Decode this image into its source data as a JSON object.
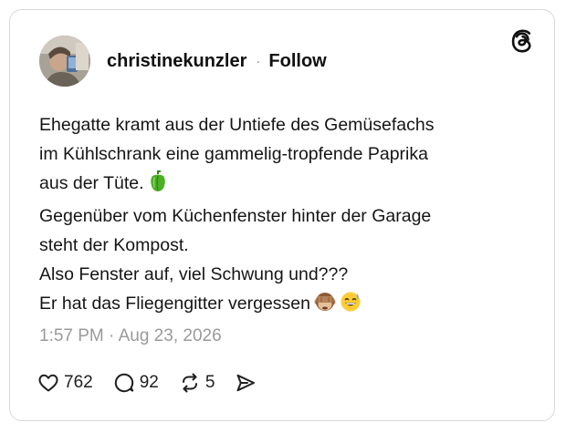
{
  "post": {
    "username": "christinekunzler",
    "separator": "·",
    "follow_label": "Follow",
    "lines": [
      "Ehegatte kramt aus der Untiefe des Gemüsefachs",
      "im Kühlschrank eine gammelig-tropfende Paprika",
      "aus der Tüte.",
      "Gegenüber vom Küchenfenster hinter der Garage",
      "steht der Kompost.",
      "Also Fenster auf, viel Schwung und???",
      "Er hat das Fliegengitter vergessen"
    ],
    "timestamp": "1:57 PM · Aug 23, 2026"
  },
  "actions": {
    "likes": "762",
    "replies": "92",
    "reposts": "5"
  },
  "icons": {
    "logo": "threads-logo-icon",
    "like": "heart-icon",
    "reply": "comment-bubble-icon",
    "repost": "repost-icon",
    "share": "send-icon"
  },
  "emoji": {
    "after_line_3": "green-pepper-emoji",
    "after_line_7": [
      "see-no-evil-monkey-emoji",
      "grinning-sweat-emoji"
    ]
  }
}
